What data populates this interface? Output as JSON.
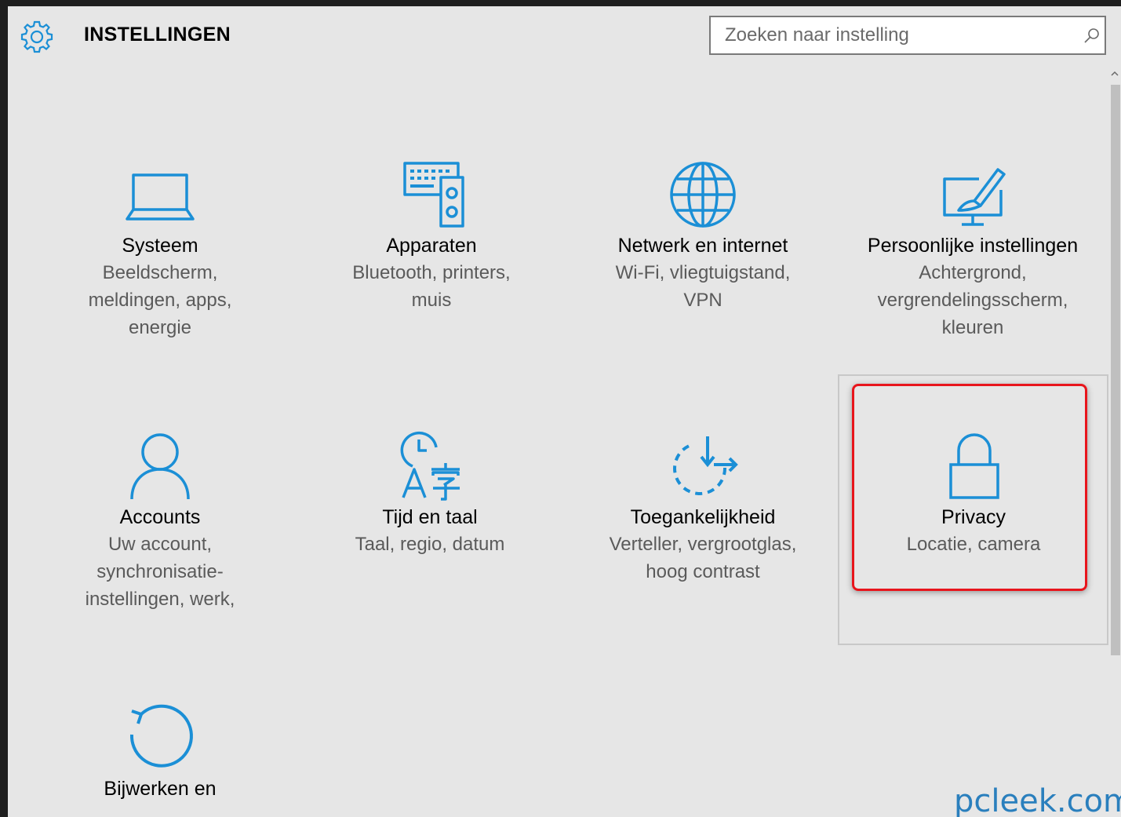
{
  "header": {
    "title": "INSTELLINGEN",
    "search_placeholder": "Zoeken naar instelling",
    "gear_icon": "gear-icon",
    "search_icon": "search-icon"
  },
  "colors": {
    "accent": "#1b8fd6",
    "background": "#e6e6e6",
    "highlight": "#e8151c",
    "watermark": "#2a7fbd"
  },
  "tiles": [
    {
      "title": "Systeem",
      "desc": [
        "Beeldscherm,",
        "meldingen, apps,",
        "energie"
      ],
      "icon": "laptop-icon"
    },
    {
      "title": "Apparaten",
      "desc": [
        "Bluetooth, printers,",
        "muis"
      ],
      "icon": "keyboard-speaker-icon"
    },
    {
      "title": "Netwerk en internet",
      "desc": [
        "Wi-Fi, vliegtuigstand,",
        "VPN"
      ],
      "icon": "globe-icon"
    },
    {
      "title": "Persoonlijke instellingen",
      "desc": [
        "Achtergrond,",
        "vergrendelingsscherm,",
        "kleuren"
      ],
      "icon": "paint-monitor-icon"
    },
    {
      "title": "Accounts",
      "desc": [
        "Uw account,",
        "synchronisatie-",
        "instellingen, werk,"
      ],
      "icon": "person-icon"
    },
    {
      "title": "Tijd en taal",
      "desc": [
        "Taal, regio, datum"
      ],
      "icon": "clock-language-icon"
    },
    {
      "title": "Toegankelijkheid",
      "desc": [
        "Verteller, vergrootglas,",
        "hoog contrast"
      ],
      "icon": "accessibility-icon"
    },
    {
      "title": "Privacy",
      "desc": [
        "Locatie, camera"
      ],
      "icon": "lock-icon"
    },
    {
      "title": "Bijwerken en",
      "desc": [],
      "icon": "update-icon"
    }
  ],
  "watermark": "pcleek.com"
}
